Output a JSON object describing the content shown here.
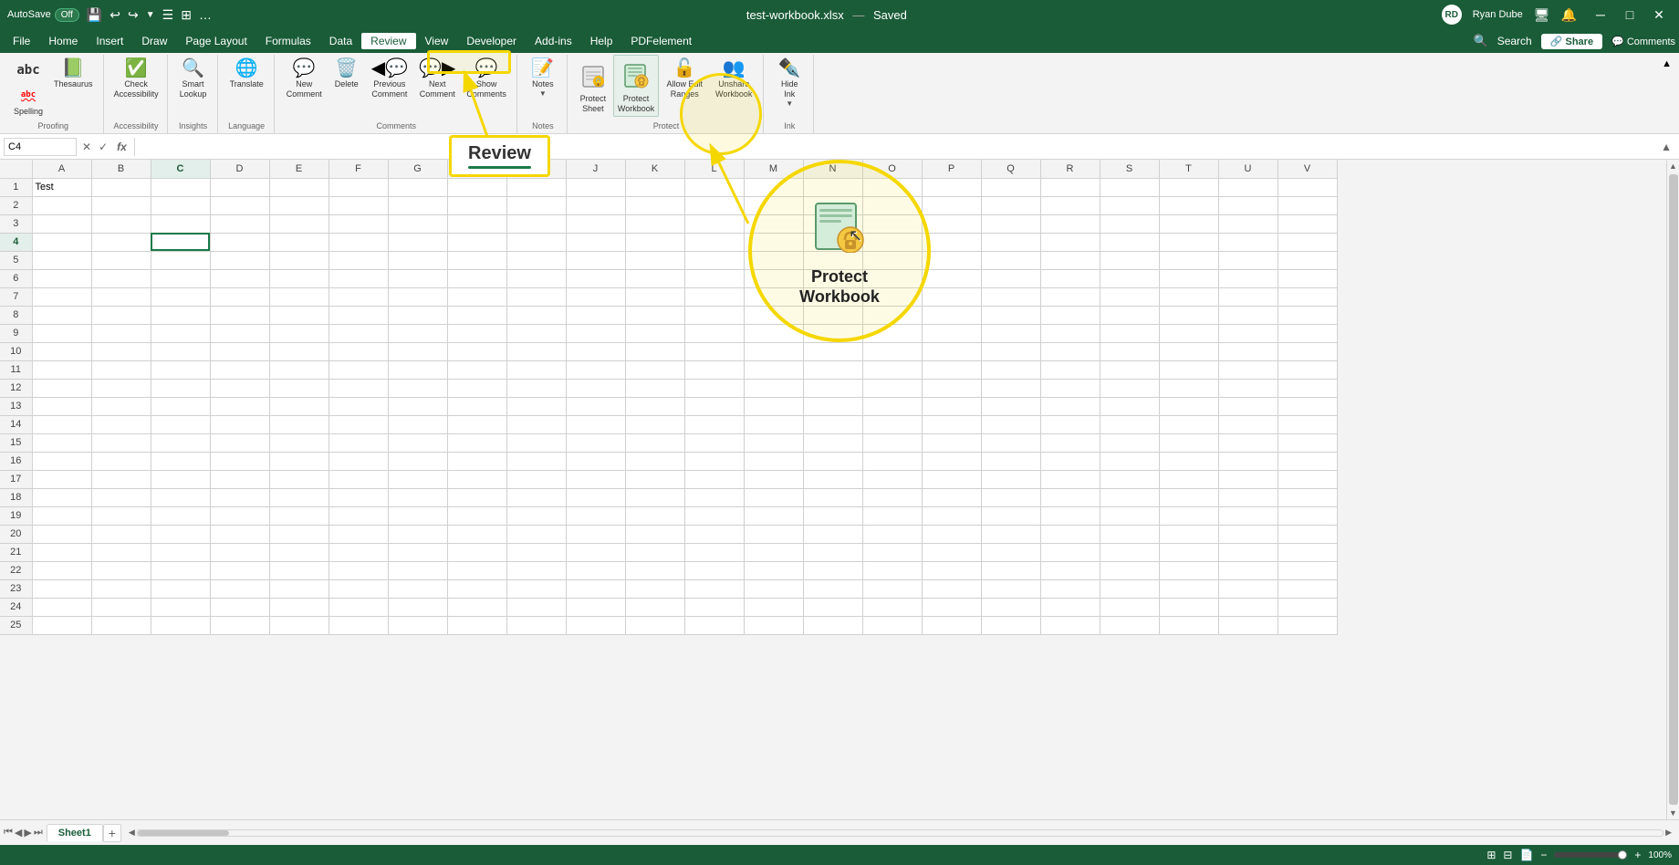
{
  "titlebar": {
    "autosave_label": "AutoSave",
    "autosave_state": "Off",
    "filename": "test-workbook.xlsx",
    "saved_status": "Saved",
    "user_name": "Ryan Dube",
    "undo_icon": "↩",
    "redo_icon": "↪",
    "minimize_icon": "─",
    "maximize_icon": "□",
    "close_icon": "✕"
  },
  "menubar": {
    "items": [
      "File",
      "Home",
      "Insert",
      "Draw",
      "Page Layout",
      "Formulas",
      "Data",
      "Review",
      "View",
      "Developer",
      "Add-ins",
      "Help",
      "PDFelement"
    ],
    "active_item": "Review",
    "search_placeholder": "Search",
    "share_label": "Share",
    "comments_label": "Comments"
  },
  "ribbon": {
    "groups": [
      {
        "label": "Proofing",
        "items": [
          {
            "id": "spelling",
            "icon": "abc",
            "label": "Spelling"
          },
          {
            "id": "thesaurus",
            "icon": "📖",
            "label": "Thesaurus"
          }
        ]
      },
      {
        "label": "Accessibility",
        "items": [
          {
            "id": "check-accessibility",
            "icon": "✓👁",
            "label": "Check\nAccessibility"
          }
        ]
      },
      {
        "label": "Insights",
        "items": [
          {
            "id": "smart-lookup",
            "icon": "🔍",
            "label": "Smart\nLookup"
          }
        ]
      },
      {
        "label": "Language",
        "items": [
          {
            "id": "translate",
            "icon": "🌐",
            "label": "Translate"
          }
        ]
      },
      {
        "label": "Comments",
        "items": [
          {
            "id": "new-comment",
            "icon": "💬+",
            "label": "New\nComment"
          },
          {
            "id": "delete",
            "icon": "🗑",
            "label": "Delete"
          },
          {
            "id": "previous-comment",
            "icon": "◀💬",
            "label": "Previous\nComment"
          },
          {
            "id": "next-comment",
            "icon": "💬▶",
            "label": "Next\nComment"
          },
          {
            "id": "show-comments",
            "icon": "💬☰",
            "label": "Show\nComments"
          }
        ]
      },
      {
        "label": "Notes",
        "items": [
          {
            "id": "notes",
            "icon": "📝",
            "label": "Notes"
          }
        ]
      },
      {
        "label": "Protect",
        "items": [
          {
            "id": "protect-sheet",
            "icon": "🔒📋",
            "label": "Protect\nSheet"
          },
          {
            "id": "protect-workbook",
            "icon": "🔒📗",
            "label": "Protect\nWorkbook"
          },
          {
            "id": "allow-edit-ranges",
            "icon": "✏️🔒",
            "label": "Allow Edit\nRanges"
          },
          {
            "id": "unshare-workbook",
            "icon": "👥",
            "label": "Unshare\nWorkbook"
          }
        ]
      },
      {
        "label": "Ink",
        "items": [
          {
            "id": "hide-ink",
            "icon": "✒️",
            "label": "Hide\nInk"
          }
        ]
      }
    ]
  },
  "formulabar": {
    "cell_ref": "C4",
    "formula_value": "",
    "cancel_icon": "✕",
    "confirm_icon": "✓",
    "formula_icon": "fx"
  },
  "columns": [
    "A",
    "B",
    "C",
    "D",
    "E",
    "F",
    "G",
    "H",
    "I",
    "J",
    "K",
    "L",
    "M",
    "N",
    "O",
    "P",
    "Q",
    "R",
    "S",
    "T",
    "U",
    "V"
  ],
  "rows": [
    1,
    2,
    3,
    4,
    5,
    6,
    7,
    8,
    9,
    10,
    11,
    12,
    13,
    14,
    15,
    16,
    17,
    18,
    19,
    20,
    21,
    22,
    23,
    24,
    25
  ],
  "cell_data": {
    "A1": "Test"
  },
  "selected_cell": "C4",
  "sheet_tabs": [
    "Sheet1"
  ],
  "active_sheet": "Sheet1",
  "statusbar": {
    "left": "",
    "zoom": "100%",
    "view_icons": [
      "normal",
      "page-break",
      "page-layout"
    ]
  },
  "highlights": {
    "review_label": "Review",
    "protect_workbook_label": "Protect\nWorkbook"
  }
}
